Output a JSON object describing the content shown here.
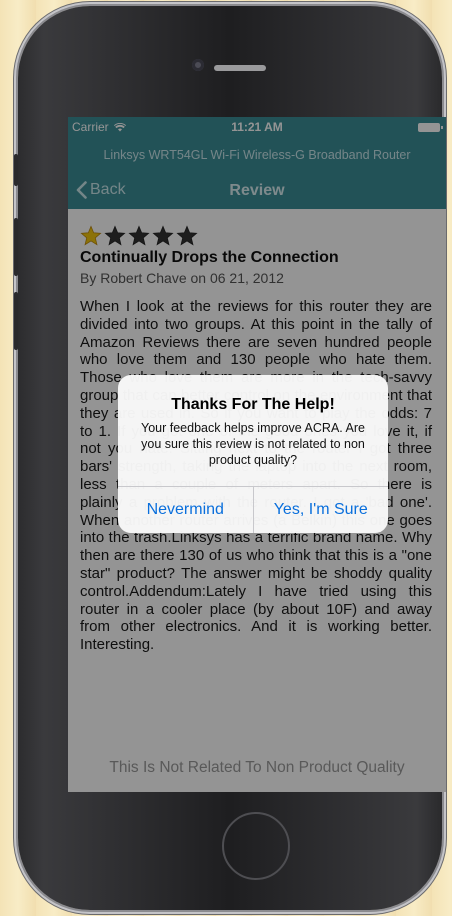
{
  "status_bar": {
    "carrier": "Carrier",
    "time": "11:21 AM"
  },
  "product_title": "Linksys WRT54GL Wi-Fi Wireless-G Broadband Router",
  "nav": {
    "back_label": "Back",
    "title": "Review"
  },
  "review": {
    "rating": 1,
    "max_rating": 5,
    "title": "Continually Drops the Connection",
    "byline": "By Robert Chave on 06 21, 2012",
    "body": "When I look at the reviews for this router they are divided into two groups.  At this point in the tally of Amazon Reviews there are seven hundred people who love them and 130 people who hate them. Those who love them are more in the tech-savvy group that can better control on the environment that they are used in. So if you want to play the odds: 7 to 1. If you got one of the good ones you love it, if not you hate. Sitting next to the router I got three bars' strength, taking the laptop into the next room, less than a couple of meters apart. So there is plainly a problem with the router.  I got a 'bad one'.  When another router arrives (a Belkin) this one goes into the trash.Linksys has a terrific brand name.  Why then are there 130 of us who think that this is a \"one star\" product?  The answer might be shoddy quality control.Addendum:Lately I have tried using this router in a cooler place (by about 10F) and away from other electronics. And it is working better.  Interesting."
  },
  "footer_link": "This Is Not Related To Non Product Quality",
  "alert": {
    "title": "Thanks For The Help!",
    "message": "Your feedback helps improve ACRA. Are you sure this review is not related to non product quality?",
    "cancel_label": "Nevermind",
    "confirm_label": "Yes, I'm Sure"
  },
  "colors": {
    "nav_background": "#3c8d97",
    "star_filled": "#f1c40f",
    "star_empty": "#333333",
    "alert_action": "#0a6fdc"
  }
}
